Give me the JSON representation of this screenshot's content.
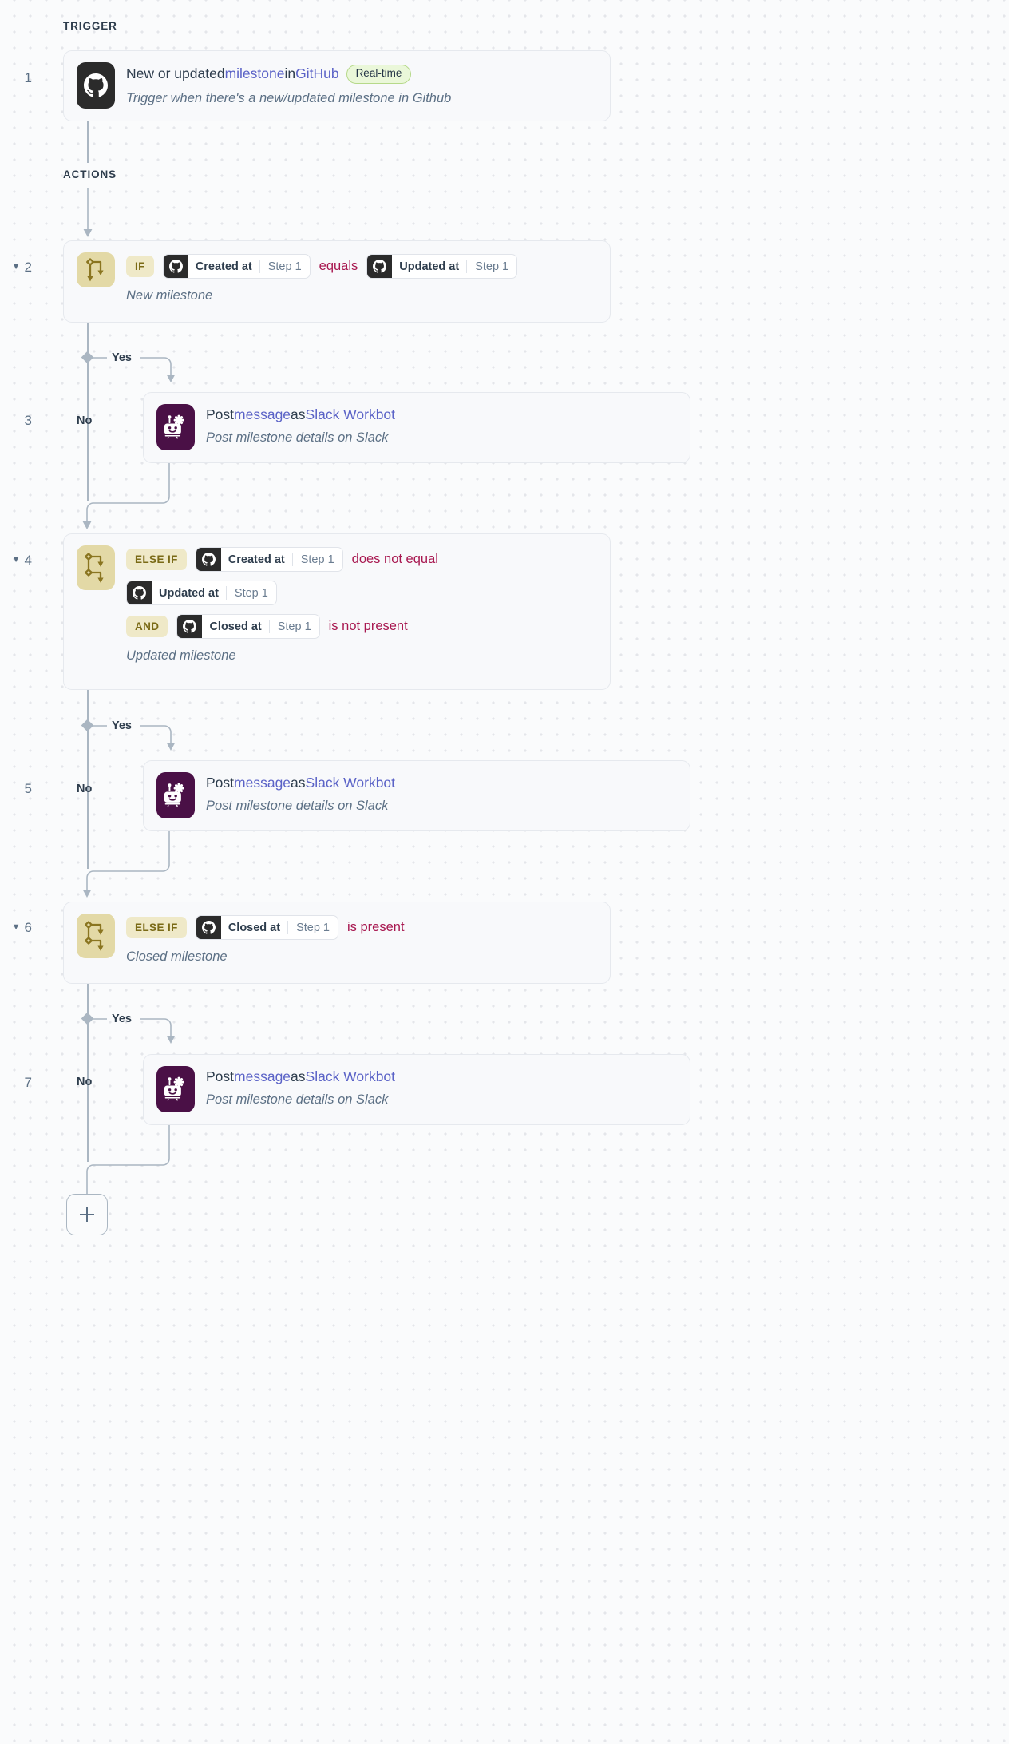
{
  "sections": {
    "trigger_label": "TRIGGER",
    "actions_label": "ACTIONS"
  },
  "colors": {
    "operator": "#a81850",
    "link": "#5b63c7",
    "branch_tile": "#e3d9a6",
    "keyword_badge_bg": "#efe9c8",
    "keyword_badge_text": "#7a6a16",
    "github_icon_bg": "#2b2b2b",
    "slack_icon_bg": "#4a1046",
    "realtime_badge_bg": "#eaf7d9",
    "realtime_badge_border": "#b6d98a",
    "connector": "#aab6c2",
    "card_bg": "#f8f9fb"
  },
  "steps": [
    {
      "number": "1",
      "collapsible": false,
      "type": "trigger",
      "icon": "github-icon",
      "title_tokens": [
        {
          "text": "New or updated ",
          "style": "plain"
        },
        {
          "text": "milestone",
          "style": "link"
        },
        {
          "text": " in ",
          "style": "plain"
        },
        {
          "text": "GitHub",
          "style": "link"
        }
      ],
      "badge": "Real-time",
      "subtitle": "Trigger when there's a new/updated milestone in Github"
    },
    {
      "number": "2",
      "collapsible": true,
      "caret": "▼",
      "type": "condition",
      "icon": "branch-single-icon",
      "rows": [
        {
          "keyword": "IF",
          "fields": [
            {
              "icon": "github-icon",
              "label": "Created at",
              "step": "Step 1"
            }
          ],
          "operator": "equals",
          "trailing_field": {
            "icon": "github-icon",
            "label": "Updated at",
            "step": "Step 1"
          }
        }
      ],
      "description": "New milestone",
      "yes_label": "Yes",
      "no_label": "No"
    },
    {
      "number": "3",
      "collapsible": false,
      "type": "action",
      "icon": "slack-workbot-icon",
      "title_tokens": [
        {
          "text": "Post ",
          "style": "plain"
        },
        {
          "text": "message",
          "style": "link"
        },
        {
          "text": " as ",
          "style": "plain"
        },
        {
          "text": "Slack Workbot",
          "style": "link"
        }
      ],
      "subtitle": "Post milestone details on Slack"
    },
    {
      "number": "4",
      "collapsible": true,
      "caret": "▼",
      "type": "condition",
      "icon": "branch-multi-icon",
      "rows": [
        {
          "keyword": "ELSE IF",
          "fields": [
            {
              "icon": "github-icon",
              "label": "Created at",
              "step": "Step 1"
            }
          ],
          "operator": "does not equal"
        },
        {
          "keyword": null,
          "fields": [
            {
              "icon": "github-icon",
              "label": "Updated at",
              "step": "Step 1"
            }
          ],
          "operator": null
        },
        {
          "keyword": "AND",
          "fields": [
            {
              "icon": "github-icon",
              "label": "Closed at",
              "step": "Step 1"
            }
          ],
          "operator": "is not present"
        }
      ],
      "description": "Updated milestone",
      "yes_label": "Yes",
      "no_label": "No"
    },
    {
      "number": "5",
      "collapsible": false,
      "type": "action",
      "icon": "slack-workbot-icon",
      "title_tokens": [
        {
          "text": "Post ",
          "style": "plain"
        },
        {
          "text": "message",
          "style": "link"
        },
        {
          "text": " as ",
          "style": "plain"
        },
        {
          "text": "Slack Workbot",
          "style": "link"
        }
      ],
      "subtitle": "Post milestone details on Slack"
    },
    {
      "number": "6",
      "collapsible": true,
      "caret": "▼",
      "type": "condition",
      "icon": "branch-multi-icon",
      "rows": [
        {
          "keyword": "ELSE IF",
          "fields": [
            {
              "icon": "github-icon",
              "label": "Closed at",
              "step": "Step 1"
            }
          ],
          "operator": "is present"
        }
      ],
      "description": "Closed milestone",
      "yes_label": "Yes",
      "no_label": "No"
    },
    {
      "number": "7",
      "collapsible": false,
      "type": "action",
      "icon": "slack-workbot-icon",
      "title_tokens": [
        {
          "text": "Post ",
          "style": "plain"
        },
        {
          "text": "message",
          "style": "link"
        },
        {
          "text": " as ",
          "style": "plain"
        },
        {
          "text": "Slack Workbot",
          "style": "link"
        }
      ],
      "subtitle": "Post milestone details on Slack"
    }
  ],
  "add_step_button": {
    "icon": "plus-icon",
    "label": "+"
  }
}
